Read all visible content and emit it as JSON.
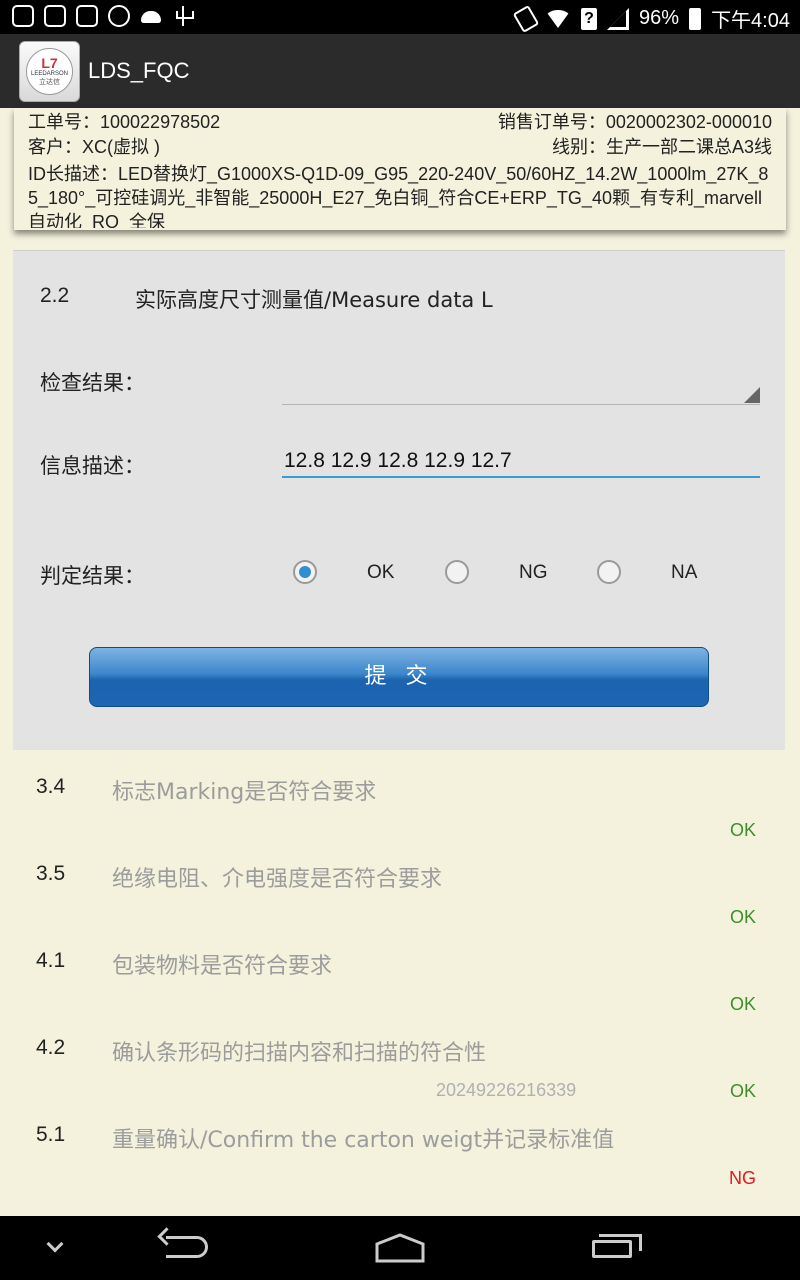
{
  "status_bar": {
    "battery": "96%",
    "time": "下午4:04",
    "icons": [
      "notification-icon",
      "app-icon",
      "app-icon-2",
      "sync-icon",
      "android-icon",
      "usb-icon",
      "vibrate-icon",
      "wifi-icon",
      "question-icon",
      "signal-icon",
      "battery-icon"
    ]
  },
  "action_bar": {
    "logo_mark": "L7",
    "logo_text": "LEEDARSON",
    "logo_cn": "立达信",
    "title": "LDS_FQC"
  },
  "order_info": {
    "work_order": "工单号：100022978502",
    "sales_order": "销售订单号：0020002302-000010",
    "customer": "客户：XC(虚拟 )",
    "line": "线别：生产一部二课总A3线",
    "id_desc": "ID长描述：LED替换灯_G1000XS-Q1D-09_G95_220-240V_50/60HZ_14.2W_1000lm_27K_85_180°_可控硅调光_非智能_25000H_E27_免白铜_符合CE+ERP_TG_40颗_有专利_marvell自动化_RO_全保"
  },
  "dialog": {
    "item_number": "2.2",
    "item_title": "实际高度尺寸测量值/Measure data   L",
    "check_result_label": "检查结果：",
    "check_result_value": "",
    "info_label": "信息描述：",
    "info_value": "12.8 12.9 12.8 12.9 12.7",
    "judge_label": "判定结果：",
    "options": [
      {
        "label": "OK",
        "checked": true
      },
      {
        "label": "NG",
        "checked": false
      },
      {
        "label": "NA",
        "checked": false
      }
    ],
    "submit_label": "提 交"
  },
  "list": {
    "items": [
      {
        "num": "3.4",
        "title": "标志Marking是否符合要求",
        "code": "",
        "result": "OK"
      },
      {
        "num": "3.5",
        "title": "绝缘电阻、介电强度是否符合要求",
        "code": "",
        "result": "OK"
      },
      {
        "num": "4.1",
        "title": "包装物料是否符合要求",
        "code": "",
        "result": "OK"
      },
      {
        "num": "4.2",
        "title": "确认条形码的扫描内容和扫描的符合性",
        "code": "20249226216339",
        "result": "OK"
      },
      {
        "num": "5.1",
        "title": "重量确认/Confirm the carton weigt并记录标准值",
        "code": "",
        "result": "NG"
      }
    ]
  },
  "colors": {
    "ok": "#3e8e2a",
    "ng": "#e01b1b",
    "accent": "#2f8fd0",
    "background": "#f4f2dd"
  },
  "nav_bar": {
    "icons": [
      "hide-keyboard-icon",
      "back-icon",
      "home-icon",
      "recent-apps-icon"
    ]
  }
}
